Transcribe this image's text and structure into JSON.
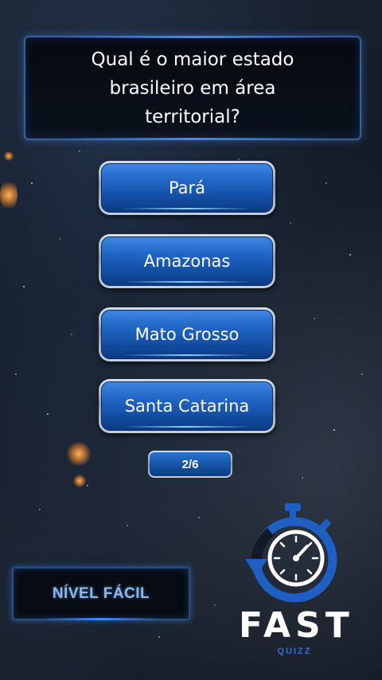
{
  "question": {
    "line1": "Qual é o maior estado",
    "line2": "brasileiro em área",
    "line3": "territorial?"
  },
  "answers": [
    {
      "label": "Pará"
    },
    {
      "label": "Amazonas"
    },
    {
      "label": "Mato Grosso"
    },
    {
      "label": "Santa Catarina"
    }
  ],
  "progress": {
    "text": "2/6",
    "current": 2,
    "total": 6
  },
  "level": {
    "label": "NÍVEL FÁCIL"
  },
  "logo": {
    "word": "FAST",
    "sub": "QUIZZ",
    "icon": "stopwatch-icon"
  },
  "colors": {
    "accent": "#1f5fc4",
    "button_top": "#3c86e0",
    "button_bottom": "#0b3b82"
  }
}
